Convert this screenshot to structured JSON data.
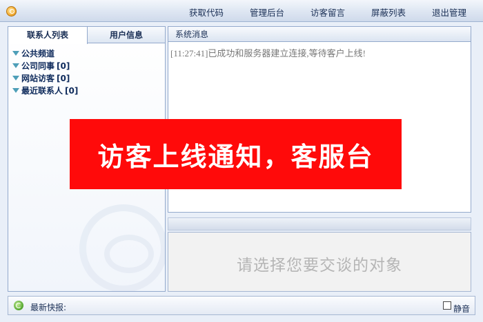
{
  "menu": {
    "items": [
      "获取代码",
      "管理后台",
      "访客留言",
      "屏蔽列表",
      "退出管理"
    ]
  },
  "left_panel": {
    "tabs": [
      "联系人列表",
      "用户信息"
    ],
    "groups": [
      {
        "label": "公共频道",
        "count": ""
      },
      {
        "label": "公司同事",
        "count": "[0]"
      },
      {
        "label": "网站访客",
        "count": "[0]"
      },
      {
        "label": "最近联系人",
        "count": "[0]"
      }
    ]
  },
  "system": {
    "title": "系统消息",
    "message": "[11:27:41]已成功和服务器建立连接,等待客户上线!"
  },
  "chat": {
    "prompt": "请选择您要交谈的对象"
  },
  "bottom": {
    "news_label": "最新快报:",
    "mute_label": "静音",
    "mute_checked": false
  },
  "banner": {
    "text": "访客上线通知，客服台"
  },
  "colors": {
    "banner_bg": "#ff0a0a",
    "panel_border": "#93a9cc",
    "tree_triangle": "#4e9fb8"
  }
}
